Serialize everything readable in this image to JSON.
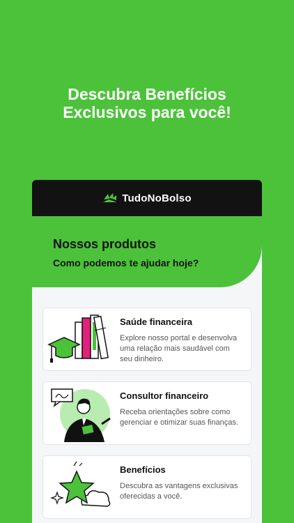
{
  "headline": {
    "line1": "Descubra Benefícios",
    "line2": "Exclusivos para você!"
  },
  "app": {
    "brand": "TudoNoBolso",
    "hero": {
      "title": "Nossos produtos",
      "subtitle": "Como podemos te ajudar hoje?"
    },
    "cards": [
      {
        "title": "Saúde financeira",
        "description": "Explore nosso portal e desenvolva uma relação mais saudável com seu dinheiro.",
        "icon": "books-graduation-cap-icon"
      },
      {
        "title": "Consultor financeiro",
        "description": "Receba orientações sobre como gerenciar e otimizar suas finanças.",
        "icon": "consultant-person-icon"
      },
      {
        "title": "Benefícios",
        "description": "Descubra as vantagens exclusivas oferecidas a você.",
        "icon": "star-cloud-icon"
      }
    ]
  },
  "colors": {
    "brand_green": "#4cc23a",
    "topbar": "#121212",
    "accent_pink": "#e0237a"
  }
}
